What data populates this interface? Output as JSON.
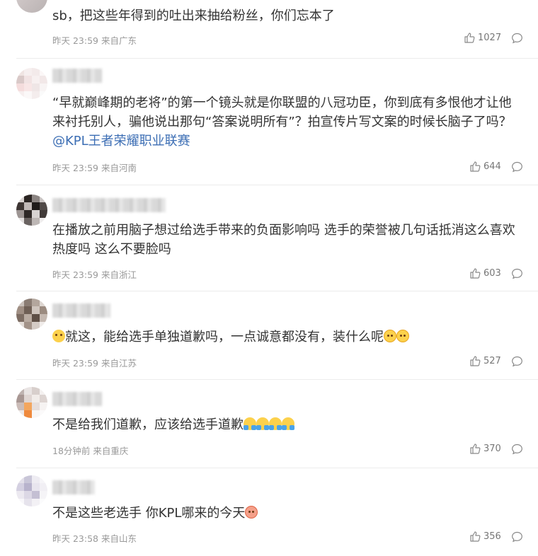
{
  "comments": [
    {
      "text": "sb，把这些年得到的吐出来抽给粉丝，你们忘本了",
      "time": "昨天 23:59 来自广东",
      "likes": "1027"
    },
    {
      "text_before": "“早就巅峰期的老将”的第一个镜头就是你联盟的八冠功臣，你到底有多恨他才让他来衬托别人，骗他说出那句“答案说明所有”？拍宣传片写文案的时候长脑子了吗？",
      "mention": "@KPL王者荣耀职业联赛",
      "time": "昨天 23:59 来自河南",
      "likes": "644"
    },
    {
      "text": "在播放之前用脑子想过给选手带来的负面影响吗 选手的荣誉被几句话抵消这么喜欢热度吗 这么不要脸吗",
      "time": "昨天 23:59 来自浙江",
      "likes": "603"
    },
    {
      "text": "就这，能给选手单独道歉吗，一点诚意都没有，装什么呢",
      "time": "昨天 23:59 来自江苏",
      "likes": "527",
      "emoji_lead": "cute-face-icon",
      "emoji_trail": [
        "smile-icon",
        "smile-icon"
      ]
    },
    {
      "text": "不是给我们道歉，应该给选手道歉",
      "time": "18分钟前 来自重庆",
      "likes": "370",
      "emoji_trail": [
        "cry-icon",
        "cry-icon",
        "cry-icon",
        "cry-icon"
      ]
    },
    {
      "text": "不是这些老选手 你KPL哪来的今天",
      "time": "昨天 23:58 来自山东",
      "likes": "356",
      "emoji_trail": [
        "pig-icon"
      ]
    }
  ]
}
